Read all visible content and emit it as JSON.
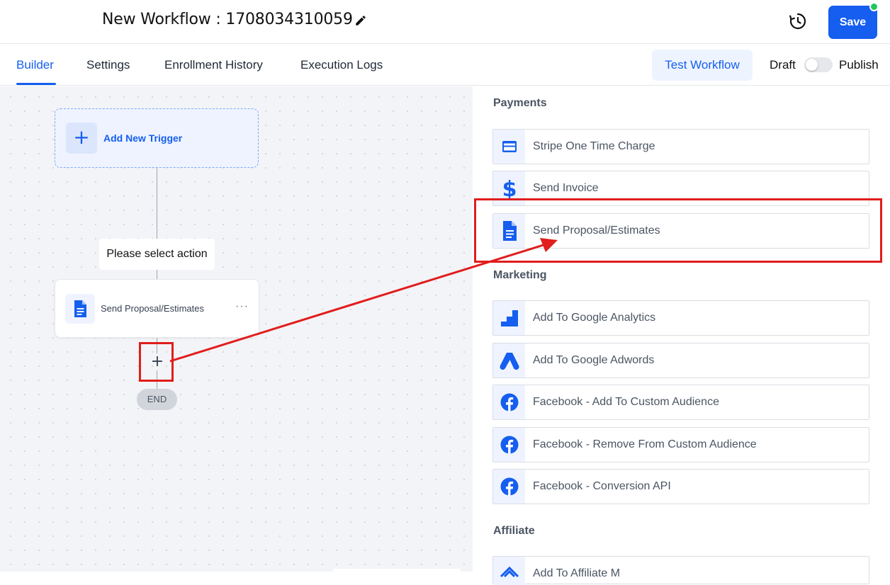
{
  "header": {
    "title": "New Workflow : 1708034310059",
    "save_label": "Save"
  },
  "tabs": [
    {
      "label": "Builder",
      "active": true
    },
    {
      "label": "Settings",
      "active": false
    },
    {
      "label": "Enrollment History",
      "active": false
    },
    {
      "label": "Execution Logs",
      "active": false
    }
  ],
  "toolbar": {
    "test_label": "Test Workflow",
    "draft_label": "Draft",
    "publish_label": "Publish",
    "publish_on": false
  },
  "canvas": {
    "trigger_label": "Add New Trigger",
    "select_action_label": "Please select action",
    "action_label": "Send Proposal/Estimates",
    "more_label": "···",
    "add_label": "+",
    "end_label": "END"
  },
  "panel": {
    "sections": [
      {
        "title": "Payments",
        "items": [
          {
            "label": "Stripe One Time Charge",
            "icon": "credit-card-icon"
          },
          {
            "label": "Send Invoice",
            "icon": "dollar-icon"
          },
          {
            "label": "Send Proposal/Estimates",
            "icon": "document-icon"
          }
        ]
      },
      {
        "title": "Marketing",
        "items": [
          {
            "label": "Add To Google Analytics",
            "icon": "google-analytics-icon"
          },
          {
            "label": "Add To Google Adwords",
            "icon": "google-ads-icon"
          },
          {
            "label": "Facebook - Add To Custom Audience",
            "icon": "facebook-icon"
          },
          {
            "label": "Facebook - Remove From Custom Audience",
            "icon": "facebook-icon"
          },
          {
            "label": "Facebook - Conversion API",
            "icon": "facebook-icon"
          }
        ]
      },
      {
        "title": "Affiliate",
        "items": [
          {
            "label": "Add To Affiliate M",
            "icon": "affiliate-icon"
          }
        ]
      }
    ]
  },
  "colors": {
    "accent": "#155eef",
    "annotation": "#e11d1d",
    "online_dot": "#22c55e"
  }
}
